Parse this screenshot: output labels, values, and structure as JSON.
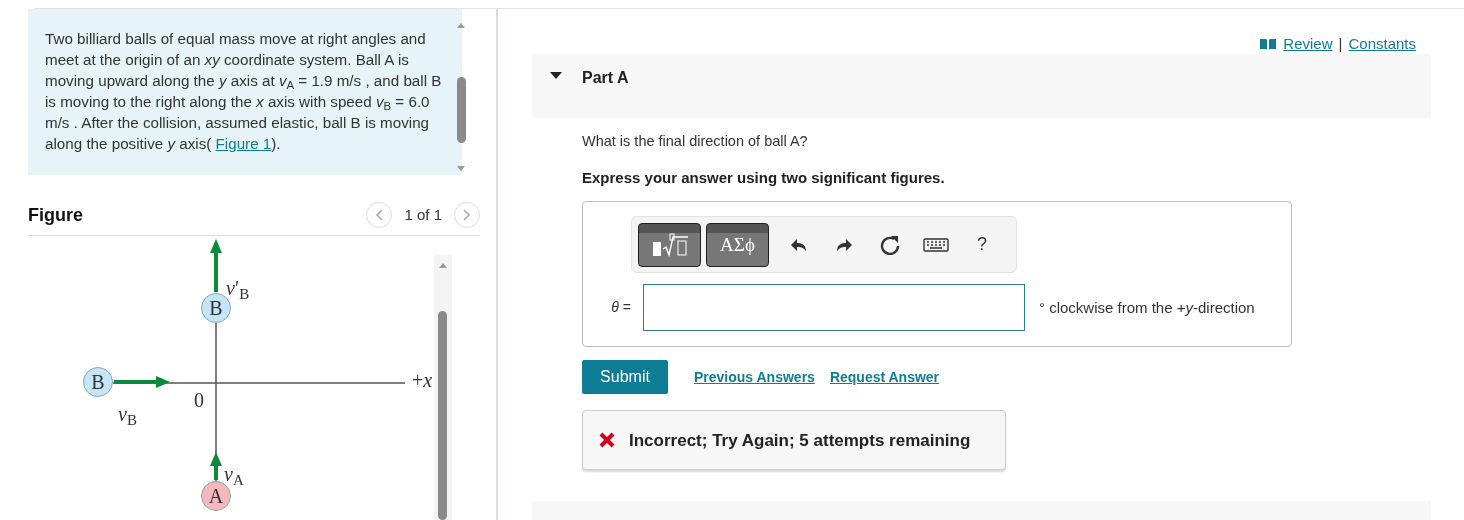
{
  "problem": {
    "text": "Two billiard balls of equal mass move at right angles and meet at the origin of an *xy* coordinate system. Ball A is moving upward along the *y* axis at *v*$_{A}$ = 1.9 m/s , and ball B is moving to the right along the *x* axis with speed *v*$_{B}$ = 6.0 m/s . After the collision, assumed elastic, ball B is moving along the positive *y* axis(",
    "link": "Figure 1",
    "after": ")."
  },
  "figure": {
    "heading": "Figure",
    "pager": "1 of 1",
    "balls": [
      {
        "label": "B",
        "color": "#c6e6f7"
      },
      {
        "label": "B",
        "color": "#c6e6f7"
      },
      {
        "label": "A",
        "color": "#f5b8bd"
      }
    ],
    "labels": [
      "*v*′$_{B}$",
      "*v*$_{B}$",
      "0",
      "+*x*",
      "*v*$_{A}$"
    ]
  },
  "links": {
    "review": "Review",
    "separator": "|",
    "constants": "Constants"
  },
  "part": {
    "title": "Part A",
    "expanded": true,
    "question": "What is the final direction of ball A?",
    "instruction": "Express your answer using two significant figures.",
    "toolbar": [
      {
        "kind": "templates"
      },
      {
        "kind": "greek",
        "label": "ΑΣϕ"
      },
      {
        "kind": "undo"
      },
      {
        "kind": "redo"
      },
      {
        "kind": "reset"
      },
      {
        "kind": "keyboard"
      },
      {
        "kind": "help",
        "label": "?"
      }
    ],
    "variable": "*θ* =",
    "unit": "° clockwise from the +*y*-direction",
    "submit": "Submit",
    "actions": [
      "Previous Answers",
      "Request Answer"
    ],
    "feedback": {
      "correct": false,
      "text": "Incorrect; Try Again; 5 attempts remaining"
    }
  }
}
